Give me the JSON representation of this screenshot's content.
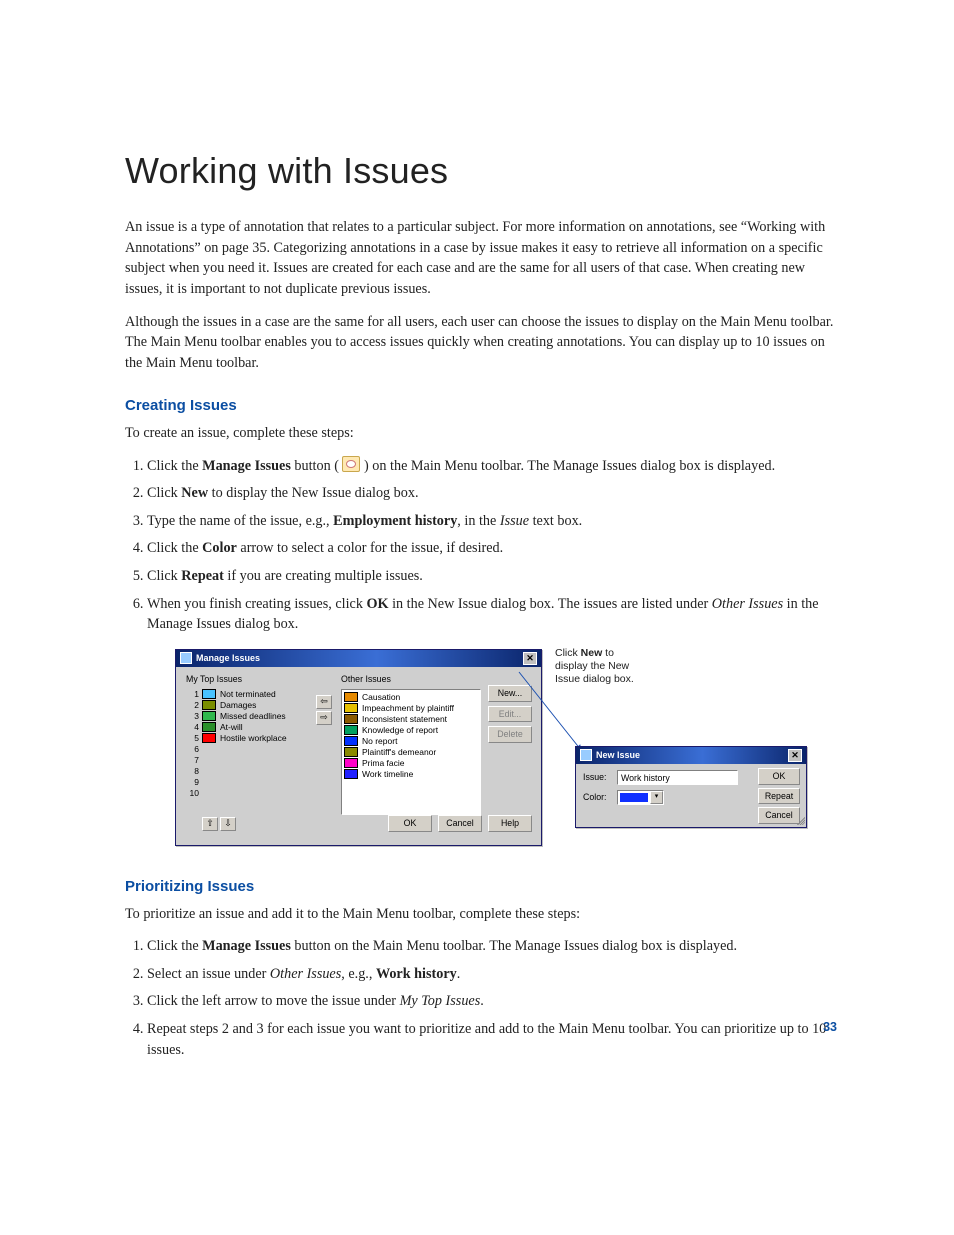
{
  "page_number": "33",
  "title": "Working with Issues",
  "intro": [
    "An issue is a type of annotation that relates to a particular subject. For more information on annotations, see “Working with Annotations” on page 35. Categorizing annotations in a case by issue makes it easy to retrieve all information on a specific subject when you need it. Issues are created for each case and are the same for all users of that case. When creating new issues, it is important to not duplicate previous issues.",
    "Although the issues in a case are the same for all users, each user can choose the issues to display on the Main Menu toolbar. The Main Menu toolbar enables you to access issues quickly when creating annotations. You can display up to 10 issues on the Main Menu toolbar."
  ],
  "section_creating": {
    "heading": "Creating Issues",
    "lead": "To create an issue, complete these steps:",
    "steps": {
      "s1a": "Click the ",
      "s1b": "Manage Issues",
      "s1c": " button ( ",
      "s1d": " ) on the Main Menu toolbar. The Manage Issues dialog box is displayed.",
      "s2a": "Click ",
      "s2b": "New",
      "s2c": " to display the New Issue dialog box.",
      "s3a": "Type the name of the issue, e.g., ",
      "s3b": "Employment history",
      "s3c": ", in the ",
      "s3d": "Issue",
      "s3e": " text box.",
      "s4a": "Click the ",
      "s4b": "Color",
      "s4c": " arrow to select a color for the issue, if desired.",
      "s5a": "Click ",
      "s5b": "Repeat",
      "s5c": " if you are creating multiple issues.",
      "s6a": "When you finish creating issues, click ",
      "s6b": "OK",
      "s6c": " in the New Issue dialog box. The issues are listed under ",
      "s6d": "Other Issues",
      "s6e": " in the Manage Issues dialog box."
    }
  },
  "section_prioritizing": {
    "heading": "Prioritizing Issues",
    "lead": "To prioritize an issue and add it to the Main Menu toolbar, complete these steps:",
    "steps": {
      "s1a": "Click the ",
      "s1b": "Manage Issues",
      "s1c": " button on the Main Menu toolbar. The Manage Issues dialog box is displayed.",
      "s2a": "Select an issue under ",
      "s2b": "Other Issues",
      "s2c": ", e.g., ",
      "s2d": "Work history",
      "s2e": ".",
      "s3a": "Click the left arrow to move the issue under ",
      "s3b": "My Top Issues",
      "s3c": ".",
      "s4": "Repeat steps 2 and 3 for each issue you want to prioritize and add to the Main Menu toolbar. You can prioritize up to 10 issues."
    }
  },
  "figure": {
    "callout": "Click New to display the New Issue dialog box.",
    "manage": {
      "title": "Manage Issues",
      "my_top_label": "My Top Issues",
      "other_label": "Other Issues",
      "my_top": [
        {
          "n": "1",
          "label": "Not terminated",
          "color": "#49c3ff"
        },
        {
          "n": "2",
          "label": "Damages",
          "color": "#7a8f00"
        },
        {
          "n": "3",
          "label": "Missed deadlines",
          "color": "#2fb84d"
        },
        {
          "n": "4",
          "label": "At-will",
          "color": "#2a8f2a"
        },
        {
          "n": "5",
          "label": "Hostile workplace",
          "color": "#ff0000"
        },
        {
          "n": "6",
          "label": "",
          "color": ""
        },
        {
          "n": "7",
          "label": "",
          "color": ""
        },
        {
          "n": "8",
          "label": "",
          "color": ""
        },
        {
          "n": "9",
          "label": "",
          "color": ""
        },
        {
          "n": "10",
          "label": "",
          "color": ""
        }
      ],
      "other": [
        {
          "label": "Causation",
          "color": "#e68a00"
        },
        {
          "label": "Impeachment by plaintiff",
          "color": "#e6c000"
        },
        {
          "label": "Inconsistent statement",
          "color": "#8a5a00"
        },
        {
          "label": "Knowledge of report",
          "color": "#00a060"
        },
        {
          "label": "No report",
          "color": "#0030ff"
        },
        {
          "label": "Plaintiff's demeanor",
          "color": "#8a8a00"
        },
        {
          "label": "Prima facie",
          "color": "#ff00c8"
        },
        {
          "label": "Work timeline",
          "color": "#2020ff"
        }
      ],
      "btn_new": "New...",
      "btn_edit": "Edit...",
      "btn_delete": "Delete",
      "btn_ok": "OK",
      "btn_cancel": "Cancel",
      "btn_help": "Help",
      "arrow_left": "⇦",
      "arrow_right": "⇨",
      "sort_up": "⇧",
      "sort_down": "⇩"
    },
    "new_issue": {
      "title": "New Issue",
      "issue_label": "Issue:",
      "issue_value": "Work history",
      "color_label": "Color:",
      "color_value": "#1030ff",
      "btn_ok": "OK",
      "btn_repeat": "Repeat",
      "btn_cancel": "Cancel"
    }
  }
}
